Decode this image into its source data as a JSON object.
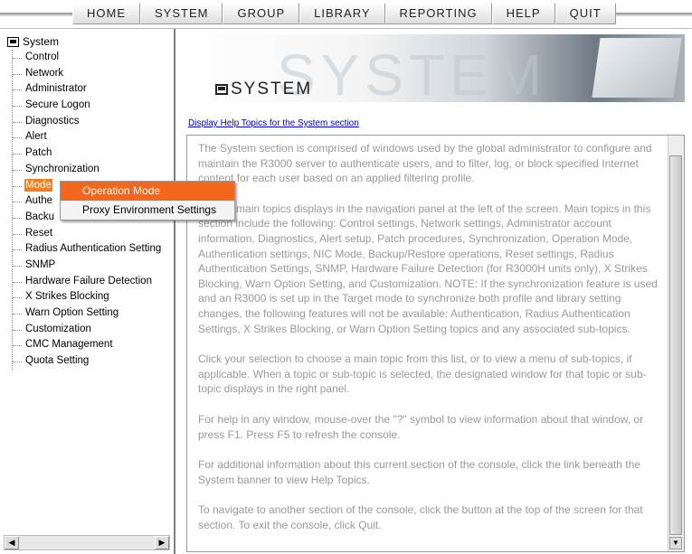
{
  "menu": [
    "HOME",
    "SYSTEM",
    "GROUP",
    "LIBRARY",
    "REPORTING",
    "HELP",
    "QUIT"
  ],
  "tree": {
    "root": "System",
    "items": [
      "Control",
      "Network",
      "Administrator",
      "Secure Logon",
      "Diagnostics",
      "Alert",
      "Patch",
      "Synchronization",
      "Mode",
      "Authe",
      "Backu",
      "Reset",
      "Radius Authentication Setting",
      "SNMP",
      "Hardware Failure Detection",
      "X Strikes Blocking",
      "Warn Option Setting",
      "Customization",
      "CMC Management",
      "Quota Setting"
    ],
    "selected": "Mode"
  },
  "context_menu": {
    "items": [
      "Operation Mode",
      "Proxy Environment Settings"
    ],
    "highlighted": "Operation Mode"
  },
  "banner": {
    "watermark": "SYSTEM",
    "title": "SYSTEM"
  },
  "help_link": "Display Help Topics for the System section",
  "content": {
    "paragraphs": [
      "The System section is comprised of windows used by the global administrator to configure and maintain the R3000 server to authenticate users, and to filter, log, or block specified Internet content for each user based on an applied filtering profile.",
      "A list of main topics displays in the navigation panel at the left of the screen. Main topics in this section include the following: Control settings, Network settings, Administrator account information, Diagnostics, Alert setup, Patch procedures, Synchronization, Operation Mode, Authentication settings, NIC Mode, Backup/Restore operations, Reset settings, Radius Authentication Settings, SNMP, Hardware Failure Detection (for R3000H units only), X Strikes Blocking, Warn Option Setting, and Customization. NOTE: If the synchronization feature is used and an R3000 is set up in the Target mode to synchronize both profile and library setting changes, the following features will not be available: Authentication, Radius Authentication Settings, X Strikes Blocking, or Warn Option Setting topics and any associated sub-topics.",
      "Click your selection to choose a main topic from this list, or to view a menu of sub-topics, if applicable. When a topic or sub-topic is selected, the designated window for that topic or sub-topic displays in the right panel.",
      "For help in any window, mouse-over the \"?\" symbol to view information about that window, or press F1. Press F5 to refresh the console.",
      "For additional information about this current section of the console, click the link beneath the System banner to view Help Topics.",
      "To navigate to another section of the console, click the button at the top of the screen for that section. To exit the console, click Quit."
    ]
  }
}
